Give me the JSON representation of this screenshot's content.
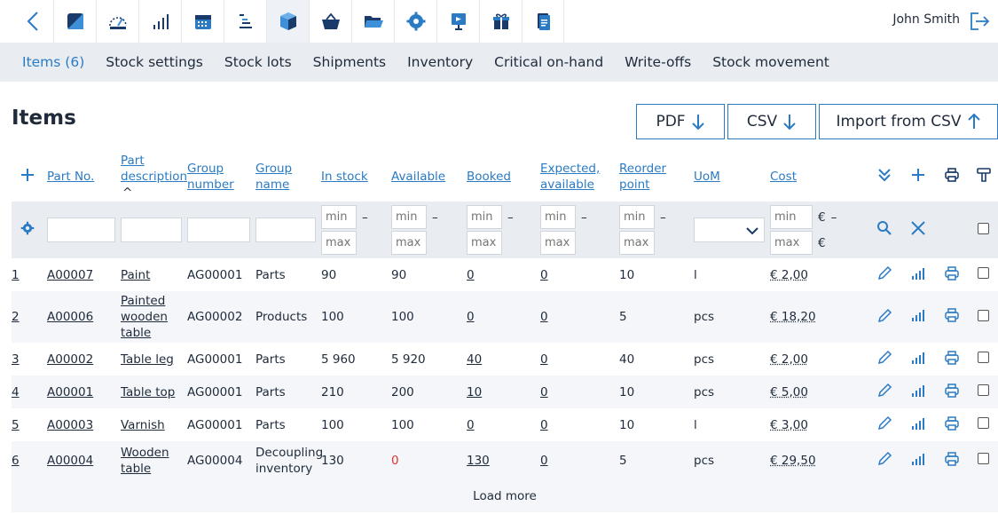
{
  "user": {
    "name": "John Smith"
  },
  "subnav": [
    {
      "label": "Items (6)",
      "active": true
    },
    {
      "label": "Stock settings"
    },
    {
      "label": "Stock lots"
    },
    {
      "label": "Shipments"
    },
    {
      "label": "Inventory"
    },
    {
      "label": "Critical on-hand"
    },
    {
      "label": "Write-offs"
    },
    {
      "label": "Stock movement"
    }
  ],
  "page": {
    "title": "Items"
  },
  "actions": {
    "pdf": "PDF",
    "csv": "CSV",
    "import": "Import from CSV"
  },
  "table": {
    "headers": {
      "part_no": "Part No.",
      "part_desc_1": "Part",
      "part_desc_2": "description",
      "sort_mark": "^",
      "group_number_1": "Group",
      "group_number_2": "number",
      "group_name_1": "Group",
      "group_name_2": "name",
      "in_stock": "In stock",
      "available": "Available",
      "booked": "Booked",
      "expected_1": "Expected,",
      "expected_2": "available",
      "reorder_1": "Reorder",
      "reorder_2": "point",
      "uom": "UoM",
      "cost": "Cost"
    },
    "filters": {
      "min": "min",
      "max": "max",
      "dash": "–",
      "euro": "€"
    },
    "rows": [
      {
        "num": "1",
        "part_no": "A00007",
        "desc": [
          "Paint"
        ],
        "group_no": "AG00001",
        "group_name": [
          "Parts"
        ],
        "in_stock": "90",
        "available": "90",
        "booked": "0",
        "expected": "0",
        "reorder": "10",
        "uom": "l",
        "cost": "€ 2,00"
      },
      {
        "num": "2",
        "part_no": "A00006",
        "desc": [
          "Painted",
          "wooden",
          "table"
        ],
        "group_no": "AG00002",
        "group_name": [
          "Products"
        ],
        "in_stock": "100",
        "available": "100",
        "booked": "0",
        "expected": "0",
        "reorder": "5",
        "uom": "pcs",
        "cost": "€ 18,20"
      },
      {
        "num": "3",
        "part_no": "A00002",
        "desc": [
          "Table leg"
        ],
        "group_no": "AG00001",
        "group_name": [
          "Parts"
        ],
        "in_stock": "5 960",
        "available": "5 920",
        "booked": "40",
        "expected": "0",
        "reorder": "40",
        "uom": "pcs",
        "cost": "€ 2,00"
      },
      {
        "num": "4",
        "part_no": "A00001",
        "desc": [
          "Table top"
        ],
        "group_no": "AG00001",
        "group_name": [
          "Parts"
        ],
        "in_stock": "210",
        "available": "200",
        "booked": "10",
        "expected": "0",
        "reorder": "10",
        "uom": "pcs",
        "cost": "€ 5,00"
      },
      {
        "num": "5",
        "part_no": "A00003",
        "desc": [
          "Varnish"
        ],
        "group_no": "AG00001",
        "group_name": [
          "Parts"
        ],
        "in_stock": "100",
        "available": "100",
        "booked": "0",
        "expected": "0",
        "reorder": "10",
        "uom": "l",
        "cost": "€ 3,00"
      },
      {
        "num": "6",
        "part_no": "A00004",
        "desc": [
          "Wooden",
          "table"
        ],
        "group_no": "AG00004",
        "group_name": [
          "Decoupling",
          "inventory"
        ],
        "in_stock": "130",
        "available": "0",
        "available_alert": true,
        "booked": "130",
        "expected": "0",
        "reorder": "5",
        "uom": "pcs",
        "cost": "€ 29,50"
      }
    ]
  },
  "load_more": "Load more",
  "colors": {
    "accent": "#2a7bc4",
    "alert": "#e2342d",
    "subnav_bg": "#e9edf2",
    "row_alt": "#f4f6f9"
  },
  "icons": {
    "apps": [
      "dashboard-icon",
      "speedometer-icon",
      "signal-bars-icon",
      "calendar-icon",
      "gantt-icon",
      "box-icon",
      "basket-icon",
      "folder-icon",
      "gear-icon",
      "presentation-icon",
      "gift-icon",
      "document-icon"
    ]
  }
}
